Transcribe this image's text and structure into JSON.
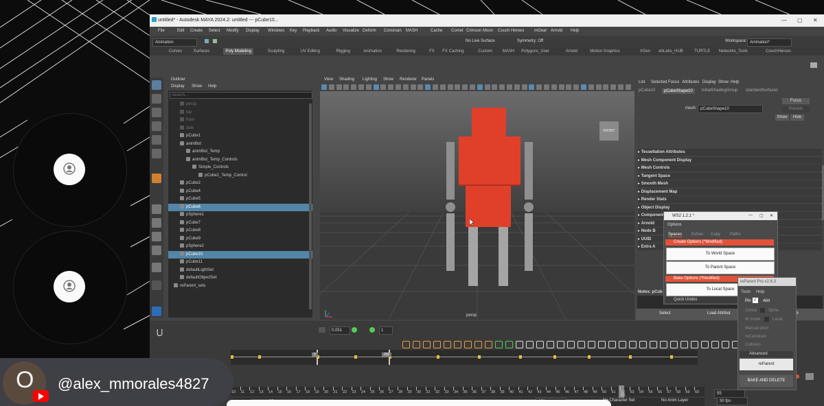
{
  "call": {
    "participants": [
      {
        "id": "p1"
      },
      {
        "id": "p2"
      }
    ]
  },
  "window": {
    "title": "untitled* - Autodesk MAYA 2024.2: untitled  ---  pCube10...",
    "controls": {
      "min": "—",
      "max": "▢",
      "close": "✕"
    },
    "menus": [
      "File",
      "Edit",
      "Create",
      "Select",
      "Modify",
      "Display",
      "Windows",
      "Key",
      "Playback",
      "Audio",
      "Visualize",
      "Deform",
      "Constrain",
      "MASH",
      "Cache",
      "Comet",
      "Crimson Moon",
      "Couch Heroes",
      "mGear",
      "Arnold",
      "Help"
    ],
    "workspace_label": "Workspace:",
    "workspace_value": "Animation*",
    "mode_value": "Animation",
    "live_surface": "No Live Surface",
    "symmetry": "Symmetry: Off",
    "shelf_tabs": [
      "Curves",
      "Surfaces",
      "Poly Modeling",
      "Sculpting",
      "UV Editing",
      "Rigging",
      "Animation",
      "Rendering",
      "FX",
      "FX Caching",
      "Custom",
      "MASH",
      "Polygons_User",
      "Arnold",
      "Motion Graphics",
      "XGen",
      "ebLabs_HUB",
      "TURTLE",
      "Networks_Tools",
      "CouchHeroes"
    ],
    "active_shelf": "Poly Modeling"
  },
  "outliner": {
    "title": "Outliner",
    "menus": [
      "Display",
      "Show",
      "Help"
    ],
    "search_placeholder": "Search...",
    "items": [
      {
        "label": "persp",
        "sel": false,
        "dim": true,
        "indent": 1
      },
      {
        "label": "top",
        "sel": false,
        "dim": true,
        "indent": 1
      },
      {
        "label": "front",
        "sel": false,
        "dim": true,
        "indent": 1
      },
      {
        "label": "side",
        "sel": false,
        "dim": true,
        "indent": 1
      },
      {
        "label": "pCube1",
        "sel": false,
        "indent": 1
      },
      {
        "label": "animBot",
        "sel": false,
        "indent": 1
      },
      {
        "label": "animBot_Temp",
        "sel": false,
        "indent": 2
      },
      {
        "label": "animBot_Temp_Controls",
        "sel": false,
        "indent": 2
      },
      {
        "label": "Simple_Controls",
        "sel": false,
        "indent": 3
      },
      {
        "label": "pCube1_Temp_Control",
        "sel": false,
        "indent": 4
      },
      {
        "label": "pCube2",
        "sel": false,
        "indent": 1
      },
      {
        "label": "pCube4",
        "sel": false,
        "indent": 1
      },
      {
        "label": "pCube5",
        "sel": false,
        "indent": 1
      },
      {
        "label": "pCube6",
        "sel": true,
        "indent": 1
      },
      {
        "label": "pSphere1",
        "sel": false,
        "indent": 1
      },
      {
        "label": "pCube7",
        "sel": false,
        "indent": 1
      },
      {
        "label": "pCube8",
        "sel": false,
        "indent": 1
      },
      {
        "label": "pCube9",
        "sel": false,
        "indent": 1
      },
      {
        "label": "pSphere2",
        "sel": false,
        "indent": 1
      },
      {
        "label": "pCube10",
        "sel": true,
        "indent": 1
      },
      {
        "label": "pCube11",
        "sel": false,
        "indent": 1
      },
      {
        "label": "defaultLightSet",
        "sel": false,
        "indent": 1
      },
      {
        "label": "defaultObjectSet",
        "sel": false,
        "indent": 1
      },
      {
        "label": "reParent_sets",
        "sel": false,
        "indent": 0
      }
    ]
  },
  "viewport": {
    "menus": [
      "View",
      "Shading",
      "Lighting",
      "Show",
      "Renderer",
      "Panels"
    ],
    "camera_label": "persp",
    "viewcube_label": "FRONT",
    "character_color": "#e0402a"
  },
  "attribute_editor": {
    "menus": [
      "List",
      "Selected",
      "Focus",
      "Attributes",
      "Display",
      "Show",
      "Help"
    ],
    "tabs": [
      "pCube10",
      "pCubeShape10",
      "initialShadingGroup",
      "standardSurface1"
    ],
    "active_tab": "pCubeShape10",
    "mesh_label": "mesh:",
    "mesh_value": "pCubeShape10",
    "focus_btn": "Focus",
    "presets_btn": "Presets",
    "show_btn": "Show",
    "hide_btn": "Hide",
    "sections": [
      "Tessellation Attributes",
      "Mesh Component Display",
      "Mesh Controls",
      "Tangent Space",
      "Smooth Mesh",
      "Displacement Map",
      "Render Stats",
      "Object Display",
      "Component Tags",
      "Arnold",
      "Node B",
      "UUID",
      "Extra A"
    ],
    "notes_label": "Notes: pCub",
    "select_btn": "Select",
    "load_btn": "Load Attribut",
    "third_btn": "ib"
  },
  "ws_dialog": {
    "title": "WS2 1.2.1 *",
    "menu": "Options",
    "tabs": [
      "Spaces",
      "Extras",
      "Copy",
      "Paths"
    ],
    "create_options": "Create Options (*Modified)",
    "btn_world": "To World Space",
    "btn_parent": "To Parent Space",
    "bake_options": "Bake Options (*Modified)",
    "btn_local": "To Local Space",
    "quick_undos": "Quick Undos"
  },
  "reparent_dialog": {
    "title": "reParent Pro v2.6.3",
    "menus": [
      "Tools",
      "Help"
    ],
    "pin": "Pin",
    "aim": "Aim",
    "global": "Global",
    "spine": "Spine",
    "ik_mode": "IK mode",
    "local": "Local",
    "manual_pivot": "Manual pivot",
    "reconstrain": "reConstrain",
    "collision": "Collision",
    "advanced": "Advanced",
    "reparent_btn": "reParent",
    "bake_delete_btn": "BAKE AND DELETE"
  },
  "timeline": {
    "field_value": "0.051",
    "step_value": "1",
    "ruler_labels": [
      "10",
      "11",
      "12",
      "13",
      "14",
      "15",
      "16",
      "17",
      "18",
      "19",
      "20",
      "21",
      "22",
      "23",
      "24",
      "25",
      "26",
      "27",
      "28",
      "29",
      "30",
      "31",
      "32",
      "33",
      "34",
      "35",
      "36",
      "37",
      "38",
      "39",
      "40",
      "41",
      "42",
      "43",
      "44",
      "45",
      "46",
      "47",
      "48",
      "49",
      "50",
      "51",
      "52",
      "53",
      "54",
      "55",
      "56",
      "57",
      "58",
      "59",
      "60"
    ],
    "marker_left": "0",
    "marker_right": "250",
    "current_frame": "55",
    "range_start": "55",
    "range_end": "250",
    "no_character": "No Character Set",
    "no_anim_layer": "No Anim Layer",
    "fps": "30 fps"
  },
  "channel": {
    "handle": "@alex_mmorales4827",
    "avatar_letter": "O"
  }
}
